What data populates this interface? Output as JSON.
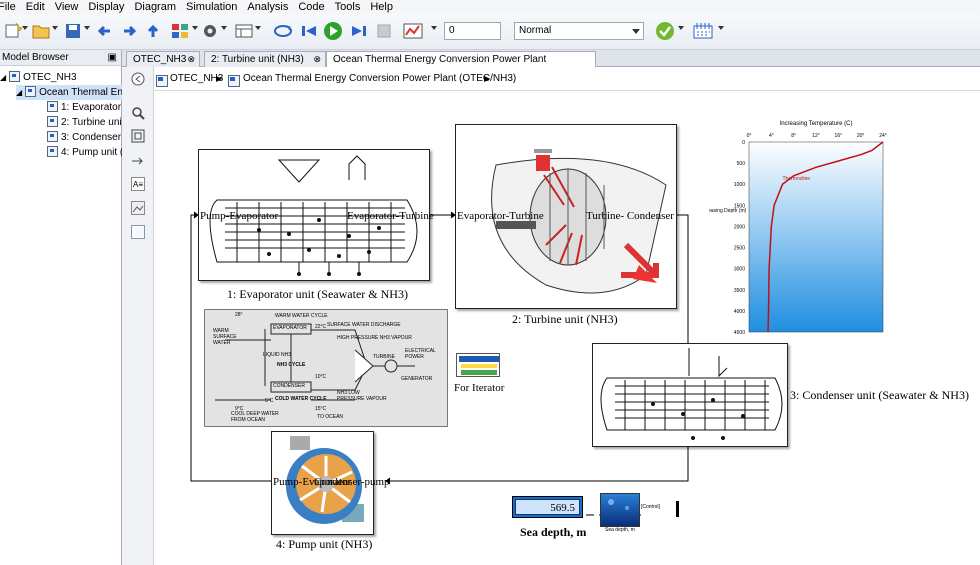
{
  "menu": [
    "File",
    "Edit",
    "View",
    "Display",
    "Diagram",
    "Simulation",
    "Analysis",
    "Code",
    "Tools",
    "Help"
  ],
  "toolbar": {
    "stop_time": "0",
    "sim_mode": "Normal"
  },
  "browser": {
    "title": "Model Browser",
    "items": [
      "OTEC_NH3",
      "Ocean Thermal Ene",
      "1: Evaporator",
      "2: Turbine unit",
      "3: Condenser u",
      "4: Pump unit ("
    ]
  },
  "tabs": [
    "OTEC_NH3",
    "2: Turbine unit (NH3)",
    "Ocean Thermal Energy Conversion Power Plant (OTEC/NH3)"
  ],
  "breadcrumb": {
    "root": "OTEC_NH3",
    "current": "Ocean Thermal Energy Conversion Power Plant (OTEC/NH3)"
  },
  "blocks": {
    "evaporator": {
      "label": "1: Evaporator unit (Seawater & NH3)",
      "port_in": "Pump-Evaporator",
      "port_out": "Evaporator-Turbine"
    },
    "turbine": {
      "label": "2: Turbine unit (NH3)",
      "port_in": "Evaporator-Turbine",
      "port_out": "Turbine- Condenser"
    },
    "condenser": {
      "label": "3: Condenser unit (Seawater & NH3)"
    },
    "pump": {
      "label": "4: Pump unit (NH3)",
      "port_in": "Pump-Evaporator",
      "port_out": "Condenser-pump"
    },
    "iterator": {
      "label": "For Iterator"
    },
    "display": {
      "value": "569.5",
      "label": "Sea depth, m"
    },
    "sea_image": {
      "caption": "Sea depth, m"
    },
    "goto": {
      "label": "[Control]"
    }
  },
  "thermo_chart": {
    "title": "Increasing Temperature (C)",
    "x_ticks": [
      "0°",
      "4°",
      "8°",
      "12°",
      "16°",
      "20°",
      "24°"
    ],
    "y_ticks": [
      "0",
      "500",
      "1000",
      "1500",
      "2000",
      "2500",
      "3000",
      "3500",
      "4000",
      "4500"
    ],
    "ylabel": "Increasing Depth (m)",
    "curve_label": "Thermocline",
    "colors": {
      "water": "#1f8fe0",
      "curve": "#c0101a"
    }
  },
  "cycle_diagram": {
    "labels": [
      "WARM WATER CYCLE",
      "SURFACE WATER DISCHARGE",
      "WARM SURFACE WATER",
      "EVAPORATOR",
      "HIGH PRESSURE NH3 VAPOUR",
      "LIQUID NH3",
      "NH3 CYCLE",
      "TURBINE",
      "ELECTRICAL POWER",
      "CONDENSER",
      "GENERATOR",
      "NH3 LOW PRESSURE VAPOUR",
      "COLD WATER CYCLE",
      "COOL DEEP WATER FROM OCEAN",
      "TO OCEAN",
      "28°",
      "22°C",
      "5°C",
      "10°C",
      "15°C",
      "9°C"
    ]
  },
  "chart_data": {
    "type": "line",
    "title": "Increasing Temperature (C)",
    "xlabel": "",
    "ylabel": "Increasing Depth (m)",
    "xlim": [
      0,
      24
    ],
    "ylim": [
      4500,
      0
    ],
    "series": [
      {
        "name": "Thermocline",
        "x": [
          24,
          23,
          22,
          20,
          16,
          12,
          8,
          6,
          4.5,
          4,
          3.8,
          3.6,
          3.5,
          3.4
        ],
        "y": [
          0,
          100,
          200,
          300,
          450,
          600,
          800,
          1000,
          1500,
          2000,
          2500,
          3000,
          4000,
          4500
        ]
      }
    ]
  }
}
